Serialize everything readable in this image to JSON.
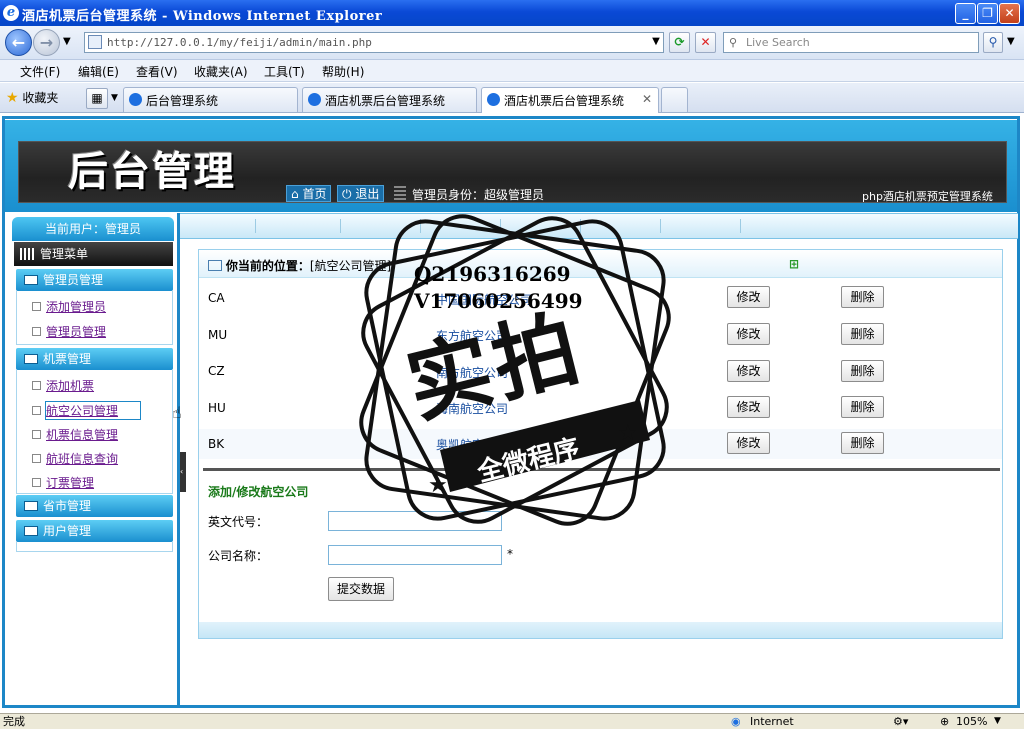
{
  "window": {
    "title": "酒店机票后台管理系统 - Windows Internet Explorer"
  },
  "browser": {
    "address": "http://127.0.0.1/my/feiji/admin/main.php",
    "search_placeholder": "Live Search",
    "menu": [
      "文件(F)",
      "编辑(E)",
      "查看(V)",
      "收藏夹(A)",
      "工具(T)",
      "帮助(H)"
    ],
    "favorites_label": "收藏夹",
    "tabs": [
      {
        "label": "后台管理系统"
      },
      {
        "label": "酒店机票后台管理系统"
      },
      {
        "label": "酒店机票后台管理系统"
      }
    ]
  },
  "header": {
    "logo": "后台管理",
    "home_label": "首页",
    "logout_label": "退出",
    "admin_identity": "管理员身份：超级管理员",
    "system_name": "php酒店机票预定管理系统"
  },
  "sidebar": {
    "current_user": "当前用户：管理员",
    "menu_title": "管理菜单",
    "groups": [
      {
        "title": "管理员管理",
        "items": [
          "添加管理员",
          "管理员管理"
        ]
      },
      {
        "title": "机票管理",
        "items": [
          "添加机票",
          "航空公司管理",
          "机票信息管理",
          "航班信息查询",
          "订票管理"
        ]
      },
      {
        "title": "省市管理",
        "items": []
      },
      {
        "title": "用户管理",
        "items": []
      }
    ]
  },
  "main": {
    "location_label": "你当前的位置：",
    "location_value": "[航空公司管理]",
    "airlines": [
      {
        "code": "CA",
        "name": "中国国际航空公司"
      },
      {
        "code": "MU",
        "name": "东方航空公司"
      },
      {
        "code": "CZ",
        "name": "南方航空公司"
      },
      {
        "code": "HU",
        "name": "海南航空公司"
      },
      {
        "code": "BK",
        "name": "奥凯航空公司"
      }
    ],
    "edit_label": "修改",
    "delete_label": "删除",
    "form": {
      "title": "添加/修改航空公司",
      "code_label": "英文代号：",
      "name_label": "公司名称：",
      "required_mark": "*",
      "submit_label": "提交数据"
    }
  },
  "watermark": {
    "qq": "Q2196316269",
    "wechat": "V17060256499",
    "big": "实拍",
    "banner": "全微程序"
  },
  "status": {
    "left": "完成",
    "zone": "Internet",
    "zoom": "105%"
  }
}
